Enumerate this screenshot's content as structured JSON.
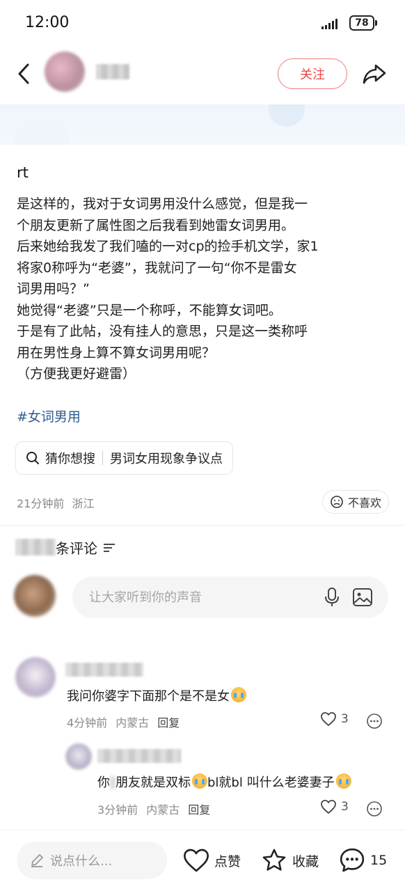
{
  "status_bar": {
    "time": "12:00",
    "battery": "78"
  },
  "header": {
    "follow_label": "关注"
  },
  "post": {
    "title": "rt",
    "lines": [
      "是这样的，我对于女词男用没什么感觉，但是我一",
      "个朋友更新了属性图之后我看到她雷女词男用。",
      "后来她给我发了我们嗑的一对cp的捡手机文学，家1",
      "将家0称呼为“老婆”，我就问了一句“你不是雷女",
      "词男用吗？”",
      "她觉得“老婆”只是一个称呼，不能算女词吧。",
      "于是有了此帖，没有挂人的意思，只是这一类称呼",
      "用在男性身上算不算女词男用呢？",
      "（方便我更好避雷）"
    ],
    "hashtag": "#女词男用",
    "search_chip": {
      "prefix": "猜你想搜",
      "query": "男词女用现象争议点"
    },
    "time": "21分钟前",
    "location": "浙江",
    "dislike_label": "不喜欢"
  },
  "comments_section": {
    "header_suffix": "条评论",
    "input_placeholder": "让大家听到你的声音",
    "comments": [
      {
        "text": "我问你婆字下面那个是不是女",
        "time": "4分钟前",
        "location": "内蒙古",
        "reply_label": "回复",
        "likes": "3"
      },
      {
        "text_a": "你",
        "text_b": "朋友就是双标",
        "text_c": "bl就bl 叫什么老婆妻子",
        "time": "3分钟前",
        "location": "内蒙古",
        "reply_label": "回复",
        "likes": "3"
      }
    ]
  },
  "bottom_bar": {
    "input_placeholder": "说点什么...",
    "like_label": "点赞",
    "collect_label": "收藏",
    "comment_count": "15"
  },
  "icons": {
    "back": "chevron-left-icon",
    "share": "share-arrow-icon",
    "search": "search-icon",
    "dislike": "sad-face-icon",
    "sort": "sort-lines-icon",
    "mic": "microphone-icon",
    "image": "image-icon",
    "heart": "heart-icon",
    "more": "more-dots-icon",
    "pencil": "pencil-icon",
    "star": "star-icon",
    "comment": "comment-bubble-icon"
  }
}
